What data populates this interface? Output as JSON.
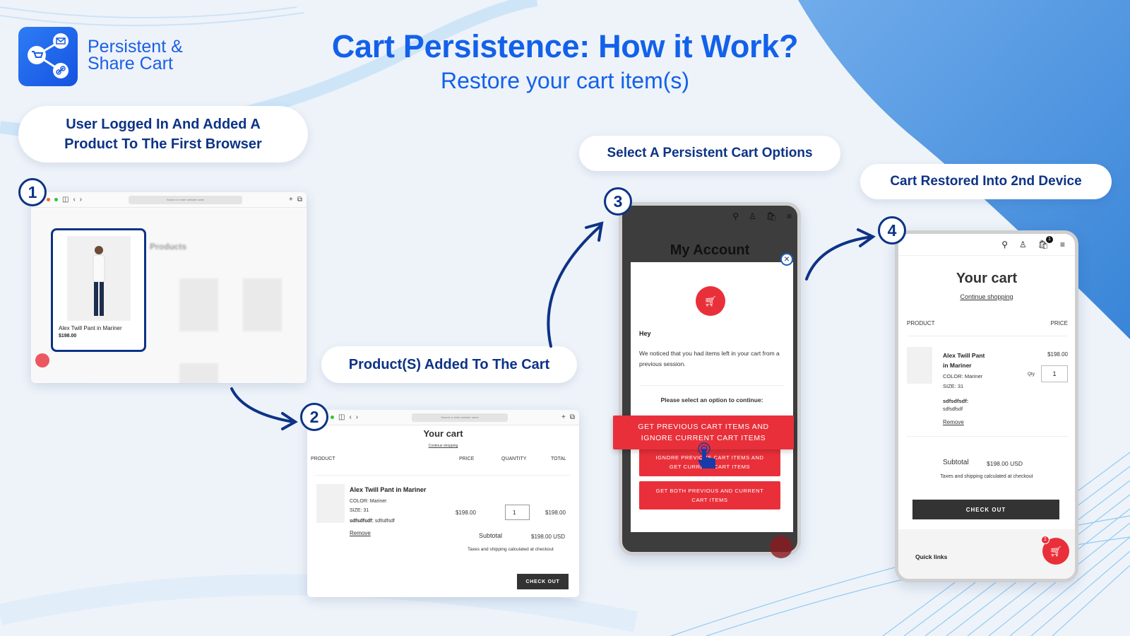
{
  "brand": {
    "line1": "Persistent &",
    "line2": "Share Cart",
    "icon": "share-cart-icon",
    "color": "#1361ea"
  },
  "header": {
    "title": "Cart Persistence: How it Work?",
    "subtitle": "Restore your cart item(s)"
  },
  "colors": {
    "accent_blue": "#1361ea",
    "navy": "#0d3386",
    "red": "#e9303a",
    "dark": "#333333"
  },
  "steps": [
    {
      "number": "1",
      "label": "User Logged In And Added A Product To The First Browser"
    },
    {
      "number": "2",
      "label": "Product(S) Added To The Cart"
    },
    {
      "number": "3",
      "label": "Select A Persistent Cart Options"
    },
    {
      "number": "4",
      "label": "Cart Restored Into 2nd Device"
    }
  ],
  "browser": {
    "url_placeholder": "Search or enter website name"
  },
  "step1": {
    "collection_title": "Products",
    "featured": {
      "name": "Alex Twill Pant in Mariner",
      "price": "$198.00"
    }
  },
  "cart_desktop": {
    "title": "Your cart",
    "continue": "Continue shopping",
    "columns": [
      "PRODUCT",
      "PRICE",
      "QUANTITY",
      "TOTAL"
    ],
    "item": {
      "name": "Alex Twill Pant in Mariner",
      "color": "COLOR: Mariner",
      "size": "SIZE: 31",
      "prop_key": "sdfsdfsdf:",
      "prop_val": "sdfsdfsdf",
      "price": "$198.00",
      "qty": "1",
      "total": "$198.00",
      "remove": "Remove"
    },
    "subtotal_label": "Subtotal",
    "subtotal_value": "$198.00 USD",
    "tax_note": "Taxes and shipping calculated at checkout",
    "checkout": "CHECK OUT"
  },
  "popup": {
    "page_title": "My Account",
    "greeting": "Hey",
    "message": "We noticed that you had items left in your cart from a previous session.",
    "prompt": "Please select an option to continue:",
    "options": [
      "GET PREVIOUS CART ITEMS AND IGNORE CURRENT CART ITEMS",
      "IGNORE PREVIOUS CART ITEMS AND GET CURRENT CART ITEMS",
      "GET BOTH PREVIOUS AND CURRENT CART ITEMS"
    ],
    "close": "×"
  },
  "cart_mobile": {
    "title": "Your cart",
    "continue": "Continue shopping",
    "columns": [
      "PRODUCT",
      "PRICE"
    ],
    "cart_count": "1",
    "item": {
      "name_line1": "Alex Twill Pant",
      "name_line2": "in Mariner",
      "color": "COLOR: Mariner",
      "size": "SIZE: 31",
      "prop_key": "sdfsdfsdf:",
      "prop_val": "sdfsdfsdf",
      "price": "$198.00",
      "qty_label": "Qty",
      "qty": "1",
      "remove": "Remove"
    },
    "subtotal_label": "Subtotal",
    "subtotal_value": "$198.00 USD",
    "tax_note": "Taxes and shipping calculated at checkout",
    "checkout": "CHECK OUT",
    "quick_links": "Quick links",
    "fab_badge": "1"
  }
}
